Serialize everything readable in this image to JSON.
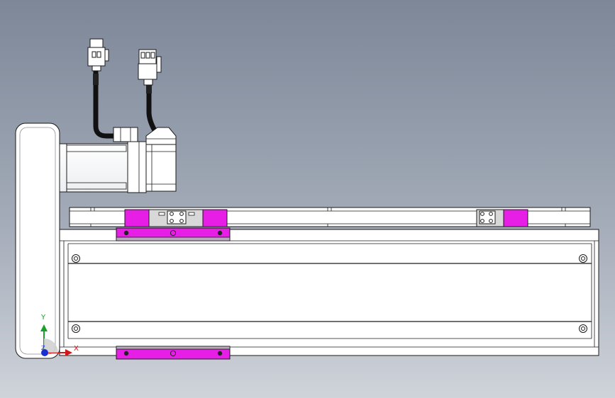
{
  "viewport": {
    "background_top": "#7d8798",
    "background_bottom": "#cfd3da"
  },
  "colors": {
    "part_fill": "#ffffff",
    "outline": "#1a1a1a",
    "highlight": "#e61ee6",
    "cable": "#111111",
    "axis_x": "#d01818",
    "axis_y": "#18a028",
    "axis_z": "#1830d0"
  },
  "triad": {
    "x_label": "X",
    "y_label": "Y",
    "z_label": "Z"
  }
}
